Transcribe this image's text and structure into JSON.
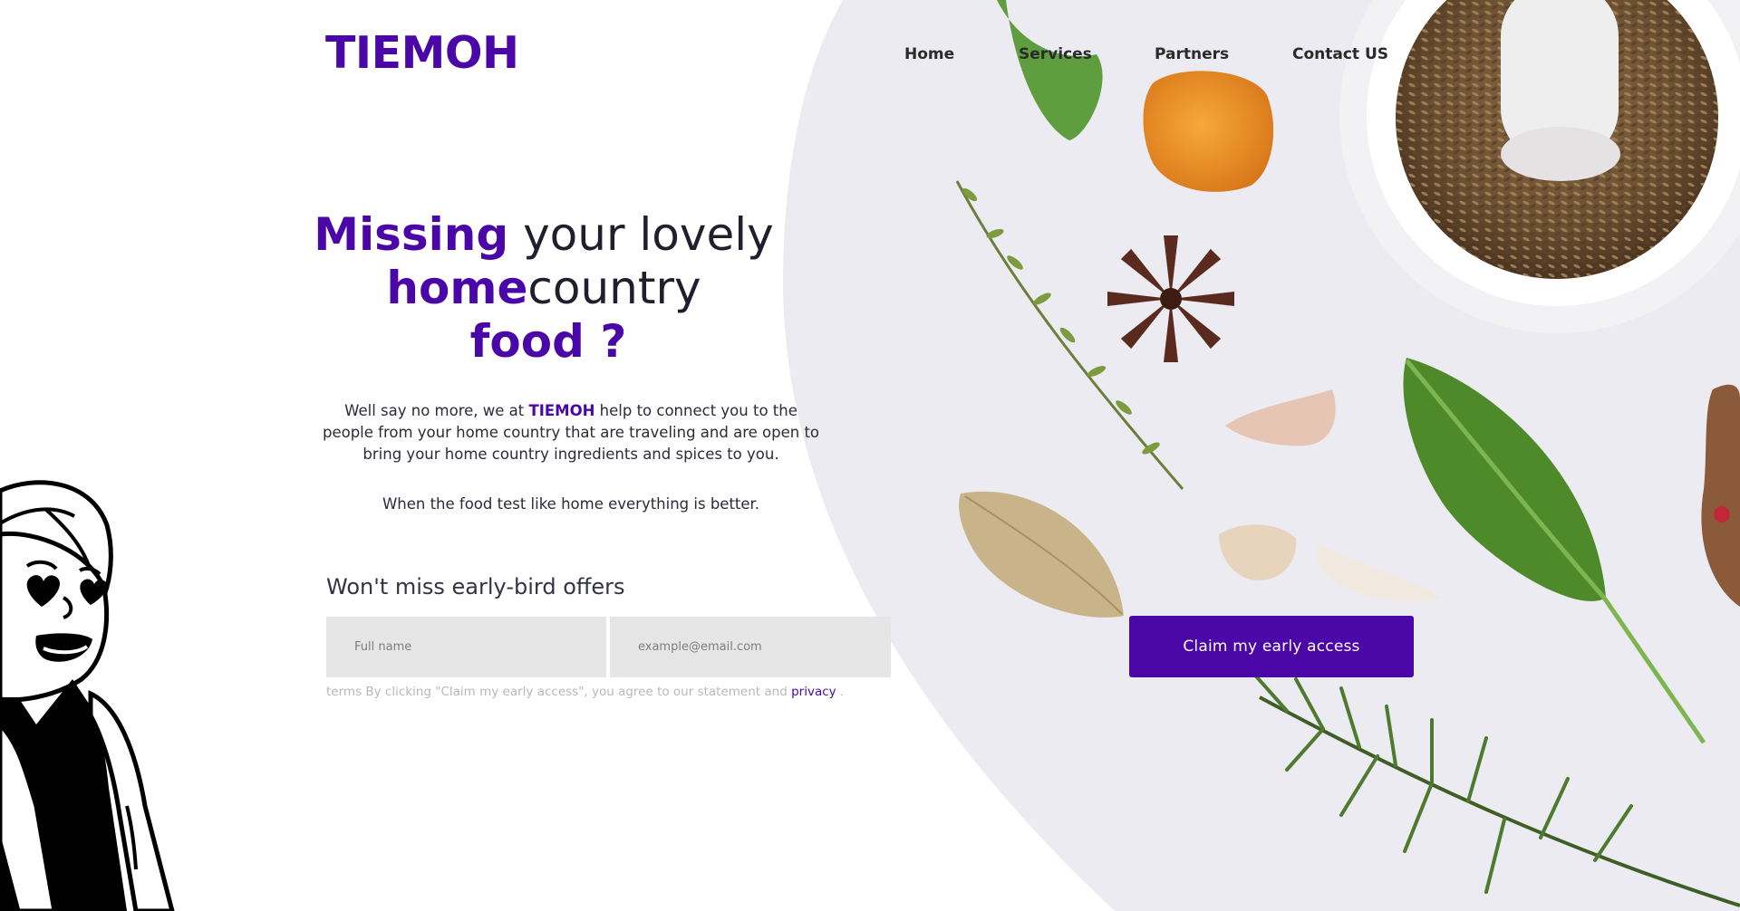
{
  "header": {
    "logo": "TIEMOH",
    "nav": [
      "Home",
      "Services",
      "Partners",
      "Contact US"
    ]
  },
  "hero": {
    "headline": {
      "line1_accent": "Missing",
      "line1_rest": " your lovely",
      "line2_accent": "home",
      "line2_rest": "country",
      "line3_accent": "food ?"
    },
    "description": {
      "before_brand": "Well say no more, we at ",
      "brand": "TIEMOH",
      "after_brand": " help to connect you to the people from your home country that are traveling and are open to bring your home country ingredients and spices to you."
    },
    "tagline": "When the food test like home everything is better."
  },
  "signup": {
    "title": "Won't miss early-bird offers",
    "name_placeholder": "Full name",
    "email_placeholder": "example@email.com",
    "terms_text": "terms By clicking \"Claim my early access\", you agree to our statement and ",
    "terms_link": "privacy",
    "terms_end": " .",
    "cta_label": "Claim my early access"
  },
  "colors": {
    "brand": "#4b06a8",
    "input_bg": "#e6e6e6",
    "photo_bg": "#ecebf1"
  },
  "icons": [
    "heart-eyes-character-illustration"
  ]
}
